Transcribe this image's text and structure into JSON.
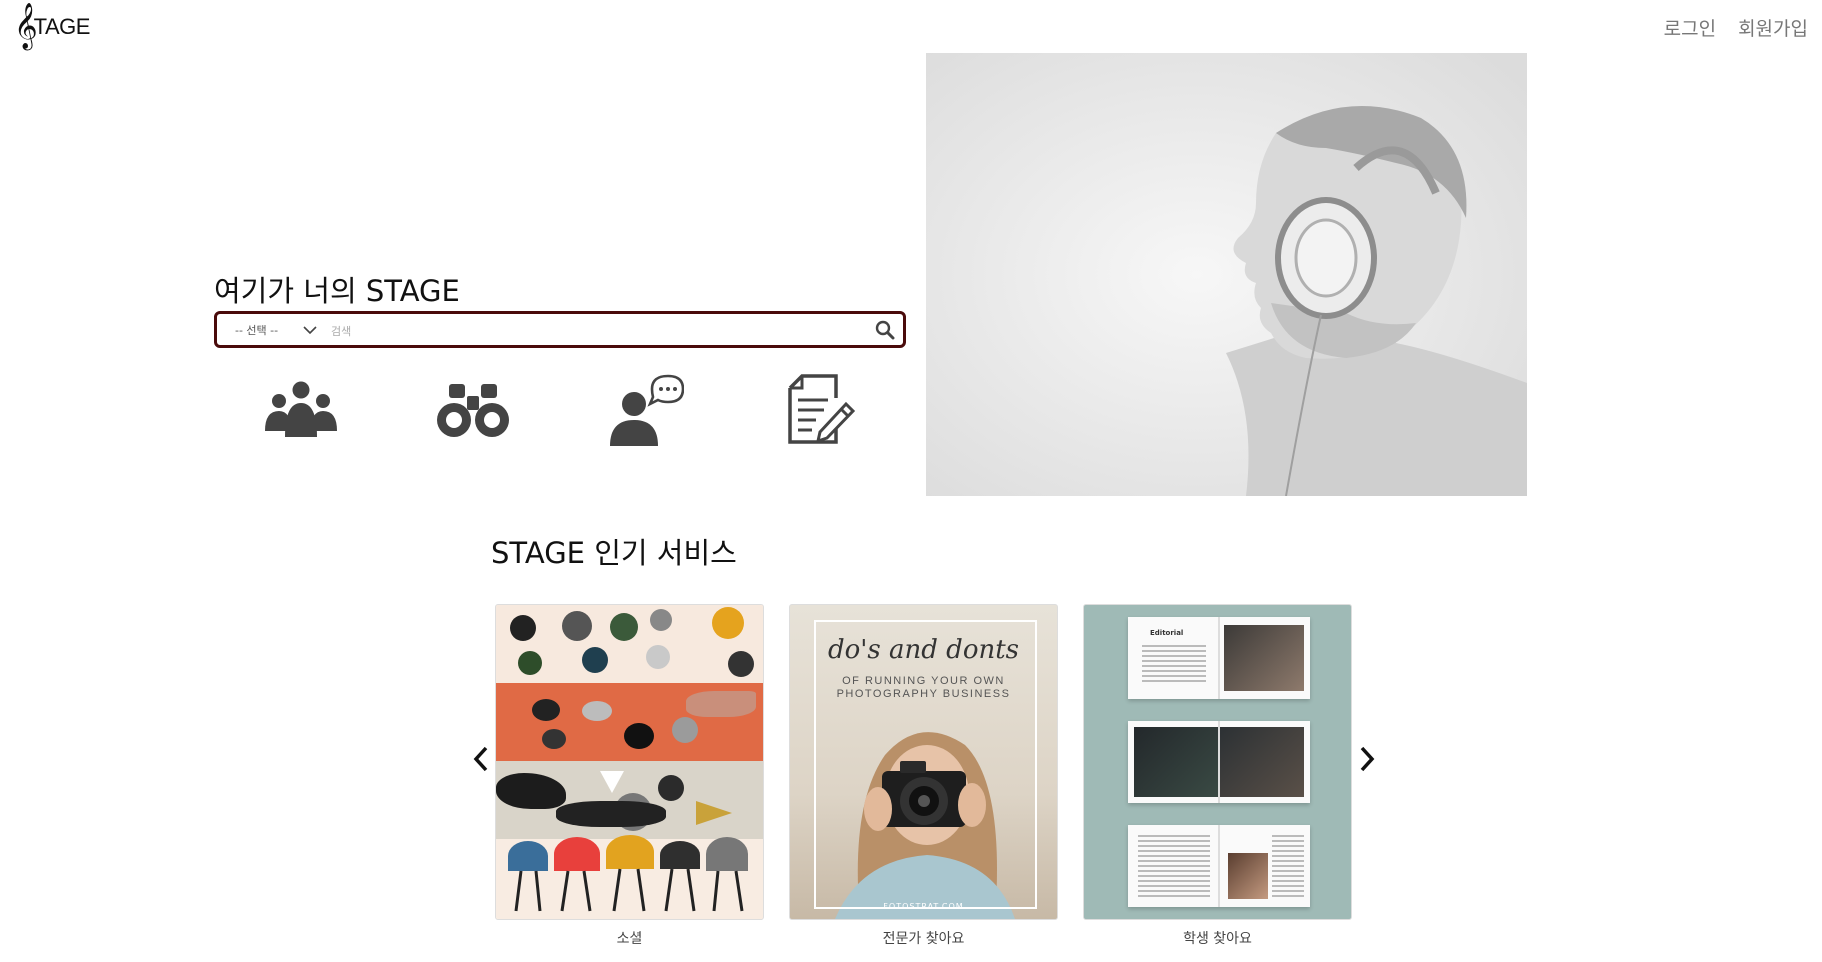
{
  "header": {
    "logo_text": "TAGE",
    "login_label": "로그인",
    "signup_label": "회원가입"
  },
  "hero": {
    "tagline": "여기가 너의 STAGE"
  },
  "search": {
    "select_value": "-- 선택 --",
    "placeholder": "검색"
  },
  "categories": [
    {
      "icon": "group-icon"
    },
    {
      "icon": "binoculars-icon"
    },
    {
      "icon": "user-chat-icon"
    },
    {
      "icon": "document-edit-icon"
    }
  ],
  "popular": {
    "title": "STAGE 인기 서비스",
    "cards": [
      {
        "label": "소셜"
      },
      {
        "label": "전문가 찾아요",
        "overlay_script": "do's and donts",
        "overlay_sub": "OF RUNNING YOUR OWN PHOTOGRAPHY BUSINESS",
        "overlay_credit": "FOTOSTRAT.COM"
      },
      {
        "label": "학생 찾아요",
        "overlay_heading": "Editorial"
      }
    ]
  },
  "colors": {
    "search_border": "#4a0b0b",
    "icon": "#444444",
    "nav_text": "#777777"
  }
}
